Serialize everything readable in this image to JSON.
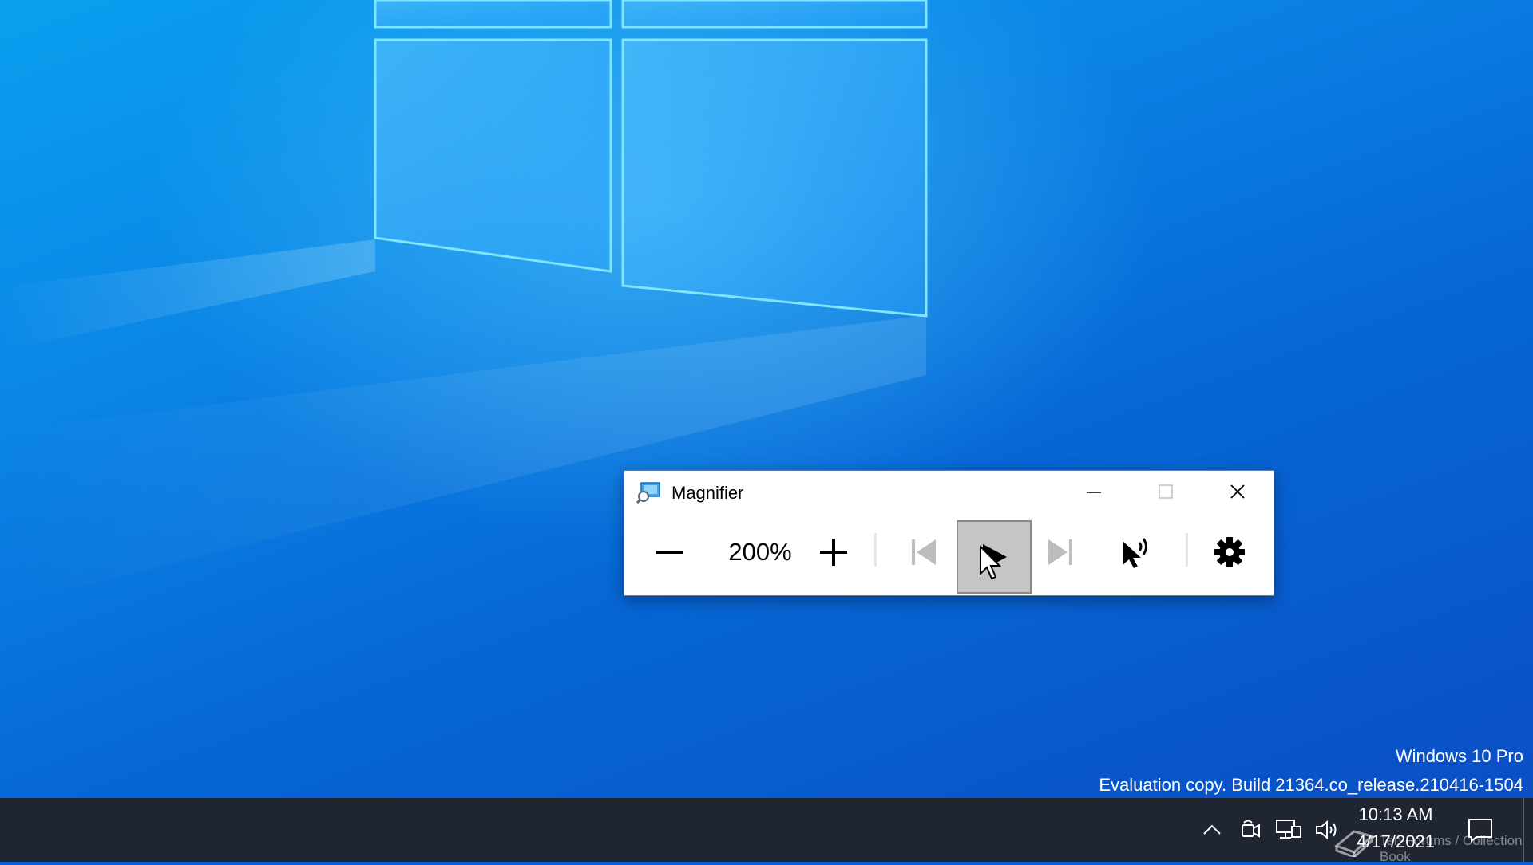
{
  "magnifier": {
    "title": "Magnifier",
    "zoom_level": "200%",
    "controls": {
      "zoom_out": "zoom-out-icon",
      "zoom_in": "zoom-in-icon",
      "previous": "previous-track-icon",
      "play": "play-icon",
      "next": "next-track-icon",
      "read_from_here": "read-from-here-icon",
      "settings": "gear-icon"
    }
  },
  "watermark": {
    "line1": "Windows 10 Pro",
    "line2": "Evaluation copy. Build 21364.co_release.210416-1504"
  },
  "taskbar": {
    "time": "10:13 AM",
    "date": "4/17/2021",
    "brand_text": "Ten Forums / Collection Book"
  },
  "colors": {
    "taskbar_bg": "#1f2631",
    "wallpaper_blue": "#0a7fe3",
    "play_button_pressed": "#c5c5c5"
  }
}
